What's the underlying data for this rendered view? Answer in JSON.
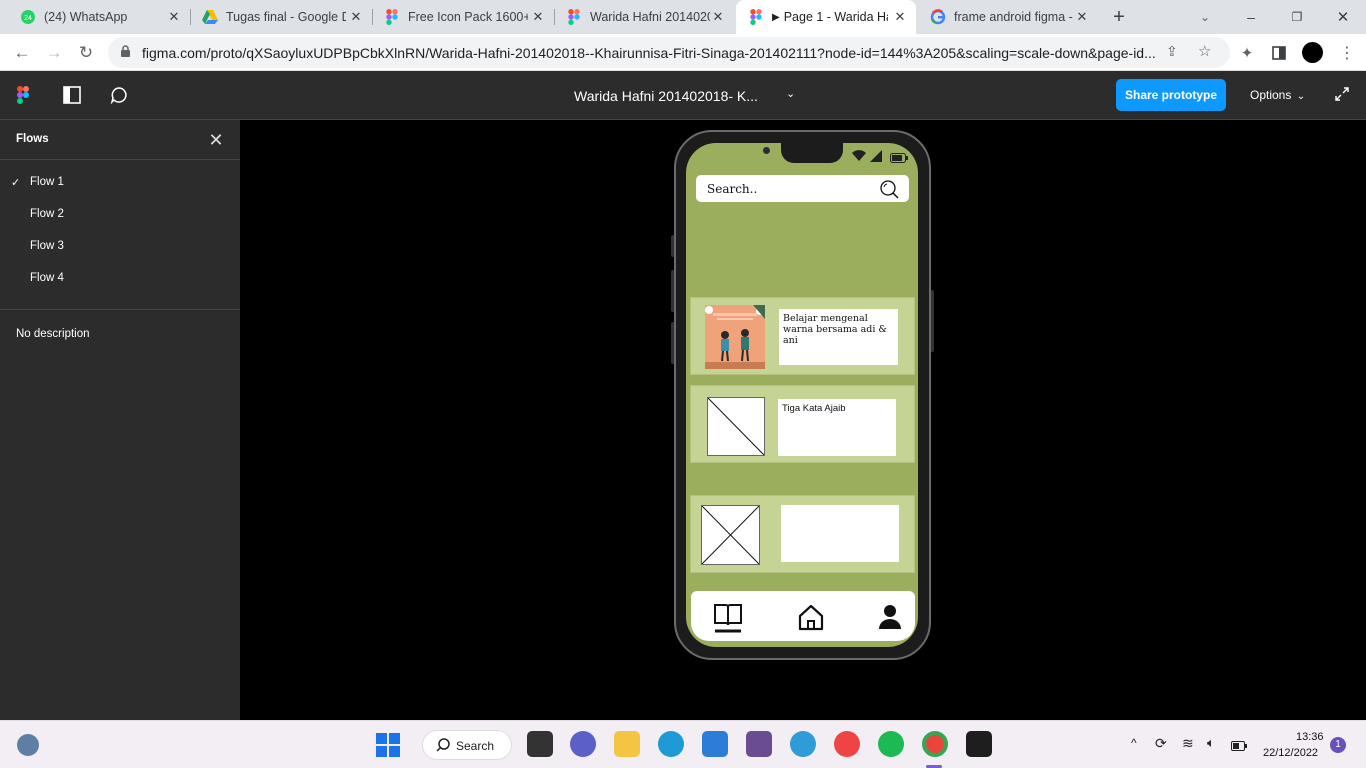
{
  "browser": {
    "tabs": [
      {
        "label": "(24) WhatsApp",
        "icon": "whatsapp-icon"
      },
      {
        "label": "Tugas final - Google D",
        "icon": "google-drive-icon"
      },
      {
        "label": "Free Icon Pack 1600+",
        "icon": "figma-icon"
      },
      {
        "label": "Warida Hafni 2014020",
        "icon": "figma-icon"
      },
      {
        "label": "Page 1 - Warida Ha",
        "icon": "figma-icon"
      },
      {
        "label": "frame android figma -",
        "icon": "google-icon"
      }
    ],
    "active_tab": 4,
    "url": "figma.com/proto/qXSaoyluxUDPBpCbkXlnRN/Warida-Hafni-201402018--Khairunnisa-Fitri-Sinaga-201402111?node-id=144%3A205&scaling=scale-down&page-id..."
  },
  "figma": {
    "file_title": "Warida Hafni 201402018- K...",
    "share_label": "Share prototype",
    "options_label": "Options",
    "flows_title": "Flows",
    "flows": [
      "Flow 1",
      "Flow 2",
      "Flow 3",
      "Flow 4"
    ],
    "selected_flow": "Flow 1",
    "description": "No description"
  },
  "app": {
    "search_placeholder": "Search..",
    "cards": [
      {
        "title": "Belajar mengenal warna bersama adi & ani",
        "thumbnail": "illustration-children"
      },
      {
        "title": "Tiga Kata Ajaib",
        "thumbnail": "image-placeholder"
      },
      {
        "title": "",
        "thumbnail": "image-placeholder"
      }
    ],
    "bottom_nav": [
      "book-icon",
      "home-icon",
      "profile-icon"
    ],
    "accent": "#9aae5d"
  },
  "taskbar": {
    "search_label": "Search",
    "time": "13:36",
    "date": "22/12/2022",
    "notification_count": "1"
  }
}
